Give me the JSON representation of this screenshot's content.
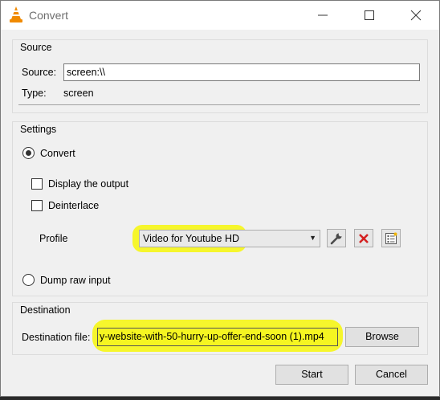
{
  "window": {
    "title": "Convert",
    "minimize_label": "Minimize",
    "maximize_label": "Maximize",
    "close_label": "Close"
  },
  "source": {
    "group_title": "Source",
    "source_label": "Source:",
    "source_value": "screen:\\\\",
    "type_label": "Type:",
    "type_value": "screen"
  },
  "settings": {
    "group_title": "Settings",
    "convert_label": "Convert",
    "convert_selected": true,
    "display_output_label": "Display the output",
    "display_output_checked": false,
    "deinterlace_label": "Deinterlace",
    "deinterlace_checked": false,
    "profile_label": "Profile",
    "profile_value": "Video for Youtube HD",
    "dump_raw_label": "Dump raw input",
    "dump_raw_selected": false
  },
  "destination": {
    "group_title": "Destination",
    "file_label": "Destination file:",
    "file_value": "y-website-with-50-hurry-up-offer-end-soon (1).mp4",
    "browse_label": "Browse"
  },
  "buttons": {
    "start_label": "Start",
    "cancel_label": "Cancel"
  },
  "colors": {
    "highlight": "#f5f521",
    "delete_red": "#d42020",
    "vlc_orange": "#f08a00"
  }
}
